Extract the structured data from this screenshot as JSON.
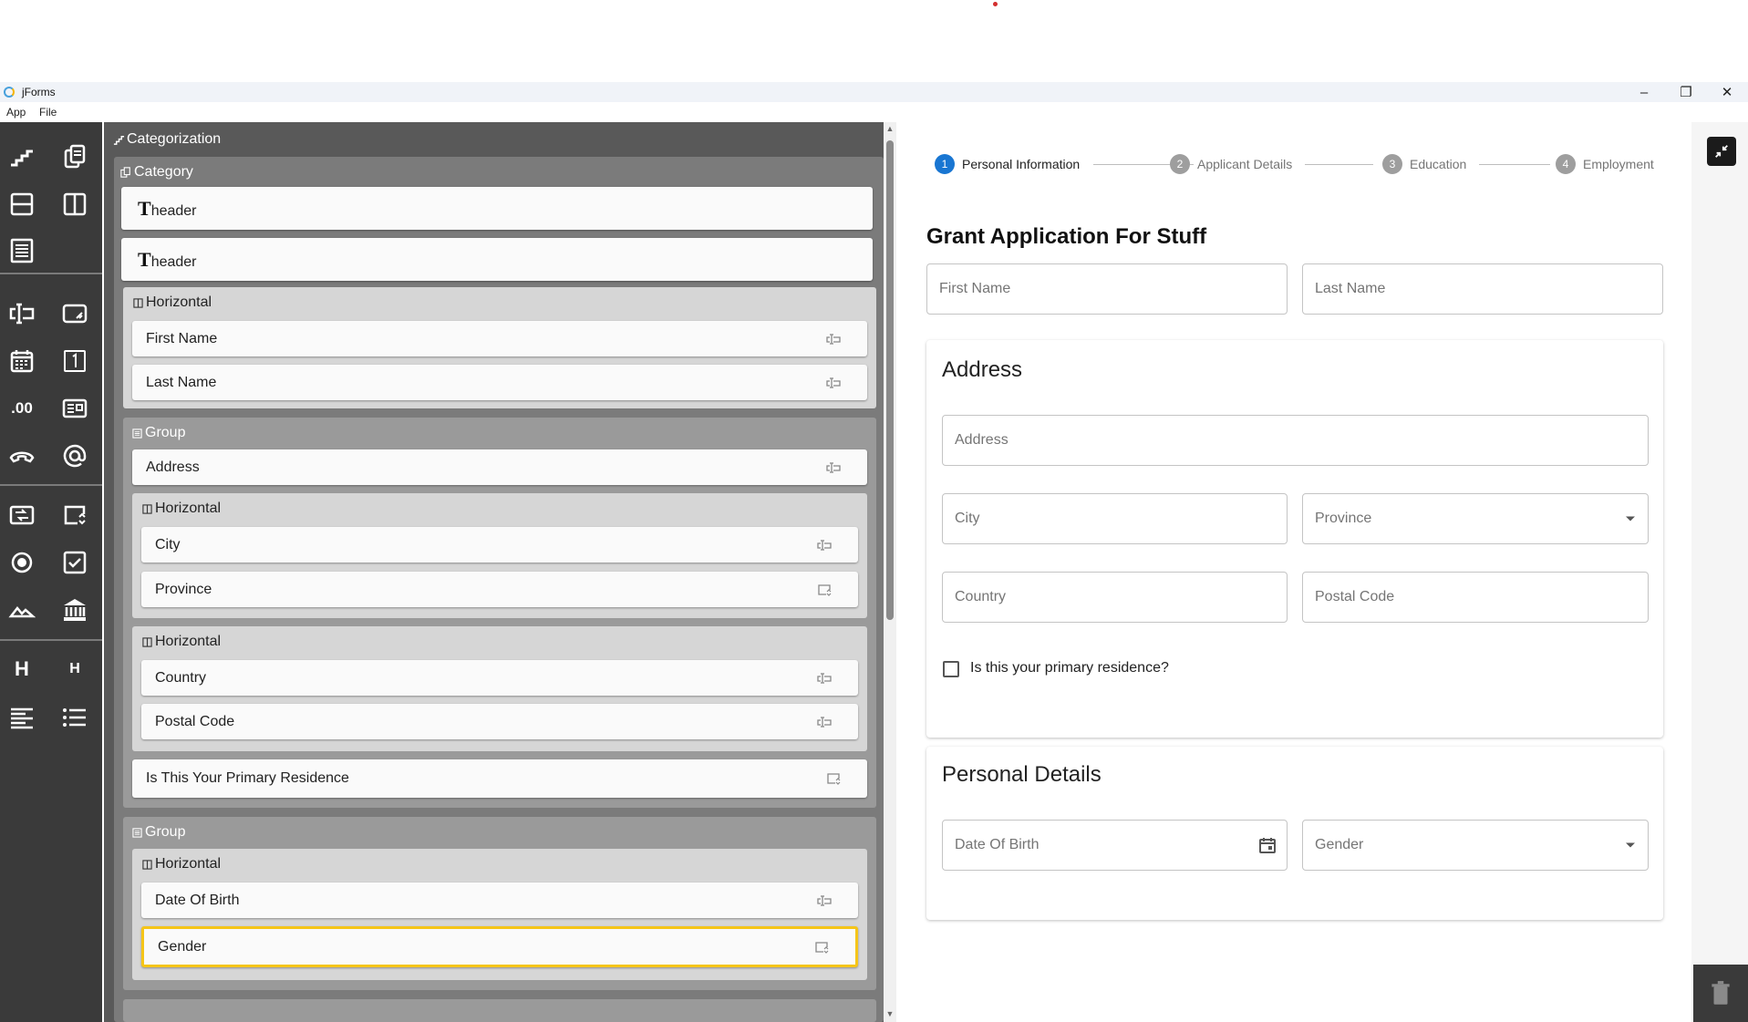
{
  "window": {
    "title": "jForms"
  },
  "menu": {
    "items": [
      "App",
      "File"
    ]
  },
  "toolbar": {
    "tools": [
      "categorization-icon",
      "copy-icon",
      "vertical-layout-icon",
      "horizontal-layout-icon",
      "group-icon",
      "text-input-icon",
      "textarea-icon",
      "date-icon",
      "integer-icon",
      ".00",
      "card-icon",
      "phone-icon",
      "email-icon",
      "swap-icon",
      "select-icon",
      "radio-icon",
      "checkbox-icon",
      "image-icon",
      "bank-icon",
      "heading-large-icon",
      "heading-small-icon",
      "paragraph-icon",
      "list-icon"
    ],
    "decimal_label": ".00",
    "h1_label": "H",
    "h2_label": "H"
  },
  "builder": {
    "categorization": "Categorization",
    "category": "Category",
    "header_t": "T",
    "header1": "header",
    "header2": "header",
    "horizontal1": {
      "title": "Horizontal",
      "fields": [
        "First Name",
        "Last Name"
      ]
    },
    "group1": {
      "title": "Group",
      "address": "Address",
      "horizontal_a": {
        "title": "Horizontal",
        "fields": [
          "City",
          "Province"
        ]
      },
      "horizontal_b": {
        "title": "Horizontal",
        "fields": [
          "Country",
          "Postal Code"
        ]
      },
      "checkbox": "Is This Your Primary Residence"
    },
    "group2": {
      "title": "Group",
      "horizontal": {
        "title": "Horizontal",
        "fields": [
          "Date Of Birth",
          "Gender"
        ]
      }
    }
  },
  "preview": {
    "steps": [
      {
        "num": "1",
        "label": "Personal Information",
        "active": true
      },
      {
        "num": "2",
        "label": "Applicant Details",
        "active": false
      },
      {
        "num": "3",
        "label": "Education",
        "active": false
      },
      {
        "num": "4",
        "label": "Employment",
        "active": false
      }
    ],
    "title": "Grant Application For Stuff",
    "first_name": "First Name",
    "last_name": "Last Name",
    "address_section": {
      "title": "Address",
      "address": "Address",
      "city": "City",
      "province": "Province",
      "country": "Country",
      "postal_code": "Postal Code",
      "primary_residence": "Is this your primary residence?"
    },
    "personal_section": {
      "title": "Personal Details",
      "dob": "Date Of Birth",
      "gender": "Gender"
    }
  },
  "colors": {
    "active_step": "#1976d2",
    "inactive_step": "#9e9e9e",
    "selected_outline": "#f5c518",
    "toolbar_bg": "#3a3a3a"
  }
}
